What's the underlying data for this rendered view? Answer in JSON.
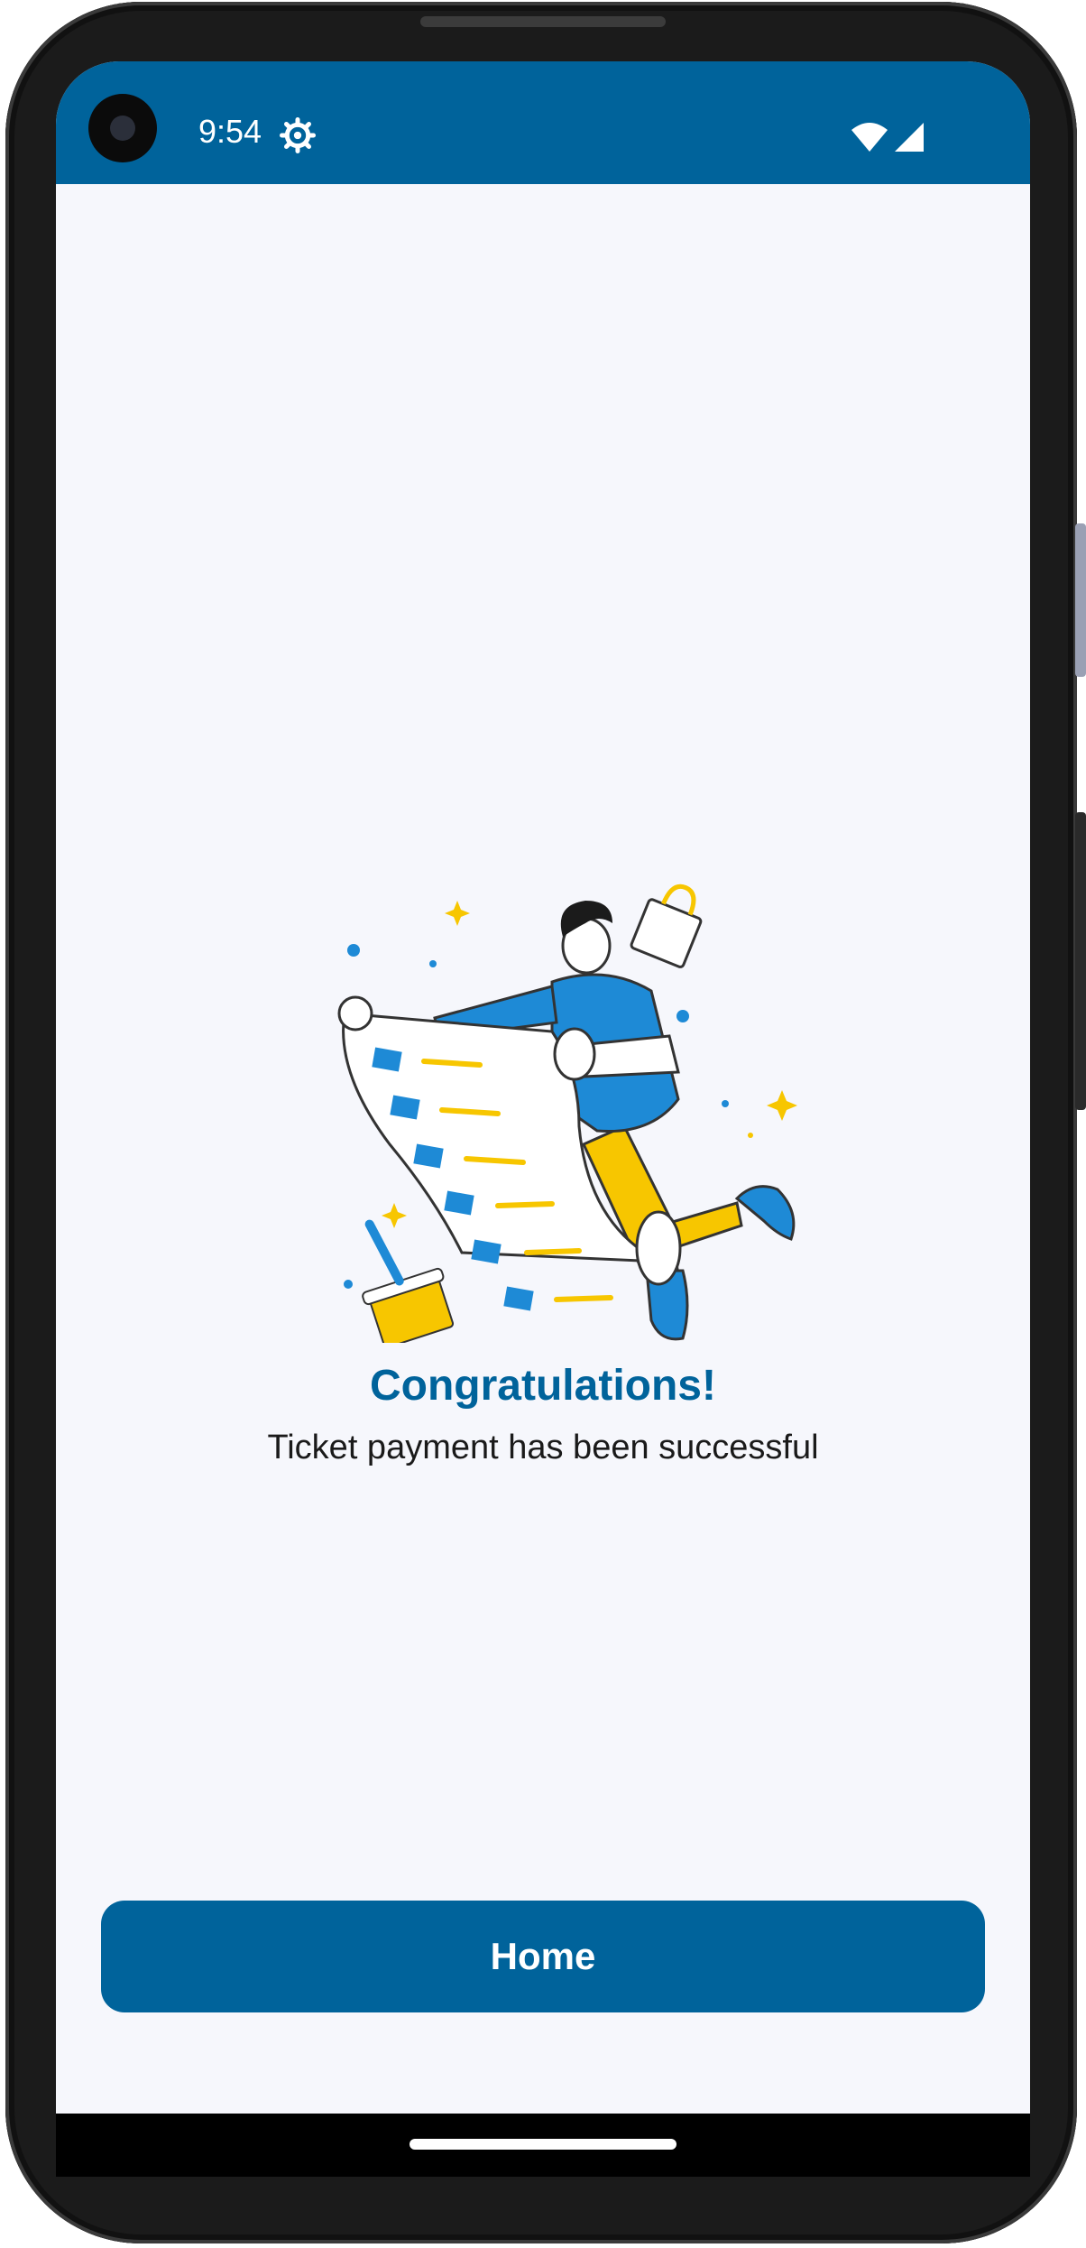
{
  "status_bar": {
    "time": "9:54",
    "icons": [
      "gear-icon",
      "wifi-icon",
      "signal-icon"
    ],
    "color": "#00639b"
  },
  "content": {
    "illustration": "man-with-receipt-illustration",
    "title": "Congratulations!",
    "subtitle": "Ticket payment has been successful"
  },
  "actions": {
    "home_label": "Home"
  },
  "colors": {
    "primary": "#00639b",
    "accent_yellow": "#f7c600",
    "accent_blue": "#1e8ad6",
    "background": "#f6f7fc"
  }
}
